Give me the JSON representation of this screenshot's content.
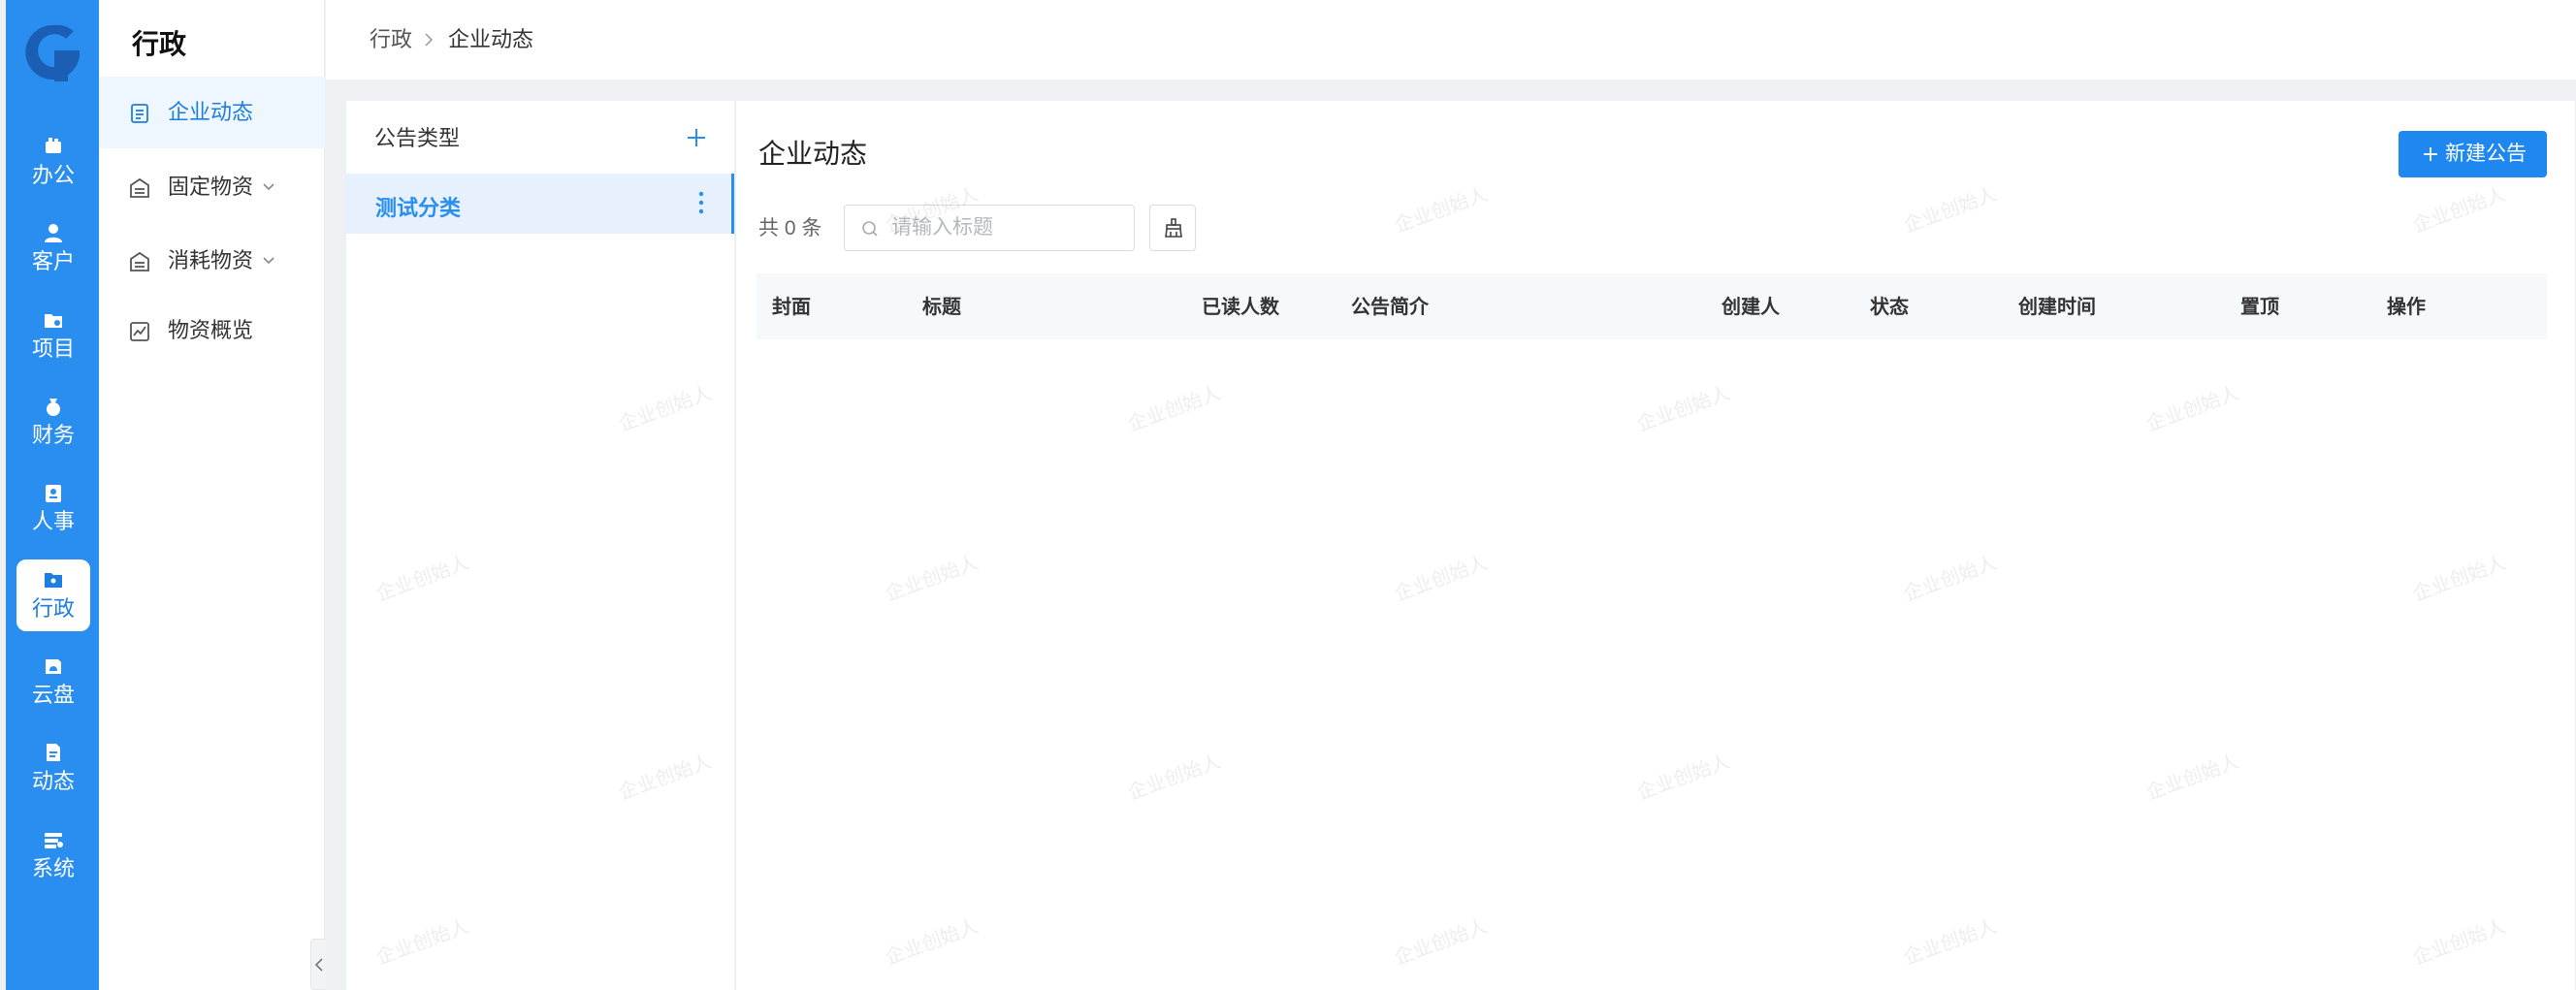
{
  "rail": {
    "items": [
      {
        "label": "办公",
        "icon": "office-icon"
      },
      {
        "label": "客户",
        "icon": "customer-icon"
      },
      {
        "label": "项目",
        "icon": "project-folder-icon"
      },
      {
        "label": "财务",
        "icon": "money-bag-icon"
      },
      {
        "label": "人事",
        "icon": "badge-icon"
      },
      {
        "label": "行政",
        "icon": "admin-folder-icon",
        "active": true
      },
      {
        "label": "云盘",
        "icon": "cloud-disk-icon"
      },
      {
        "label": "动态",
        "icon": "news-icon"
      },
      {
        "label": "系统",
        "icon": "system-settings-icon"
      }
    ]
  },
  "sidebar": {
    "title": "行政",
    "items": [
      {
        "label": "企业动态",
        "icon": "document-icon",
        "active": true
      },
      {
        "label": "固定物资",
        "icon": "warehouse-icon",
        "expandable": true
      },
      {
        "label": "消耗物资",
        "icon": "warehouse-icon",
        "expandable": true
      },
      {
        "label": "物资概览",
        "icon": "chart-icon"
      }
    ]
  },
  "breadcrumb": {
    "items": [
      "行政",
      "企业动态"
    ]
  },
  "categories": {
    "title": "公告类型",
    "items": [
      {
        "label": "测试分类",
        "selected": true
      }
    ]
  },
  "main": {
    "title": "企业动态",
    "new_button_label": "新建公告",
    "count_text": "共 0 条",
    "search_placeholder": "请输入标题",
    "columns": [
      "封面",
      "标题",
      "已读人数",
      "公告简介",
      "创建人",
      "状态",
      "创建时间",
      "置顶",
      "操作"
    ]
  },
  "watermark_text": "企业创始人",
  "colors": {
    "rail_bg": "#2a8ef0",
    "accent": "#1e88f0",
    "selected_bg": "#e6f1fd"
  }
}
